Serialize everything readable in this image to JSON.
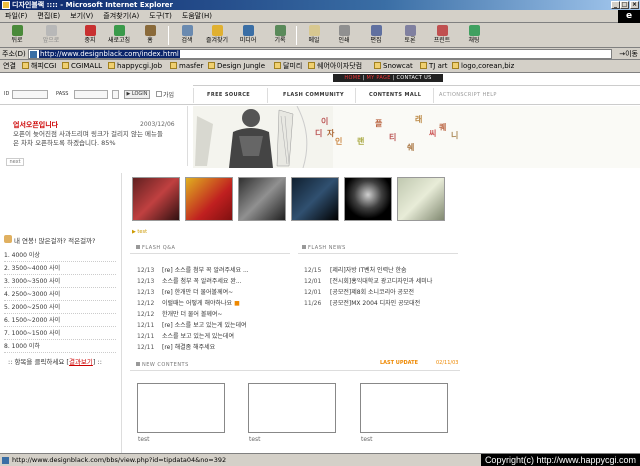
{
  "window": {
    "title": "디자인블랙 :::: - Microsoft Internet Explorer"
  },
  "menu": [
    "파일(F)",
    "편집(E)",
    "보기(V)",
    "즐겨찾기(A)",
    "도구(T)",
    "도움말(H)"
  ],
  "toolbar": {
    "back": "뒤로",
    "forward": "앞으로",
    "stop": "중지",
    "refresh": "새로고침",
    "home": "홈",
    "search": "검색",
    "favorites": "즐겨찾기",
    "media": "미디어",
    "history": "기록",
    "mail": "메일",
    "print": "인쇄",
    "edit": "편집",
    "discuss": "토론",
    "printpro": "프린트",
    "messenger": "채팅"
  },
  "address": {
    "label": "주소(D)",
    "url": "http://www.designblack.com/index.html",
    "go": "이동"
  },
  "links": {
    "label": "연결",
    "items": [
      "해피CGI",
      "CGIMALL",
      "happycgi.Job",
      "masfer",
      "Design Jungle",
      "달미리",
      "쉐어아이자닷컴",
      "Snowcat",
      "TJ art",
      "logo,corean,biz"
    ]
  },
  "site": {
    "topmenu": {
      "home": "HOME",
      "mypage": "MY PAGE",
      "contact": "CONTACT US"
    },
    "login": {
      "id_label": "ID",
      "pw_label": "PASS",
      "button": "▶ LOGIN",
      "join": "가입"
    },
    "nav": [
      "FREE SOURCE",
      "FLASH COMMUNITY",
      "CONTENTS MALL",
      "ACTIONSCRIPT HELP"
    ],
    "notice": {
      "title": "업서오픈입니다",
      "date": "2003/12/06",
      "body": "오픈이 늦어진점 사과드리며 링크가 걸리지 않는 메뉴들은 차차 오픈하도록 하겠습니다. 85%",
      "next": "next"
    },
    "hero_chars": [
      "이",
      "디",
      "자",
      "인",
      "플",
      "랜",
      "래",
      "쉐",
      "씨",
      "퀘",
      "니",
      "티"
    ],
    "test_link": "▶ test",
    "poll": {
      "question": "내 연봉! 많은걸까? 적은걸까?",
      "options": [
        "1. 4000 이상",
        "2. 3500~4000 사이",
        "3. 3000~3500 사이",
        "4. 2500~3000 사이",
        "5. 2000~2500 사이",
        "6. 1500~2000 사이",
        "7. 1000~1500 사이",
        "8. 1000 이하"
      ],
      "hint": ":: 항목을 클릭하세요 ",
      "result": "결과보기",
      "close": " ::"
    },
    "flash_qna": {
      "title": "FLASH Q&A",
      "rows": [
        {
          "date": "12/13",
          "text": "[re] 소스를 첨부 꼭 알려주세요 ..."
        },
        {
          "date": "12/13",
          "text": "소스를 첨부 꼭 알려주세요 완..."
        },
        {
          "date": "12/13",
          "text": "[re] 한개만 더 물어볼께여~"
        },
        {
          "date": "12/12",
          "text": "이럴때는 어떻게 해야하나요"
        },
        {
          "date": "12/12",
          "text": "한개만 더 물어 볼께여~"
        },
        {
          "date": "12/11",
          "text": "[re] 소스를 보고 있는게 있는데여"
        },
        {
          "date": "12/11",
          "text": "소스를 보고 있는게 있는데여"
        },
        {
          "date": "12/11",
          "text": "[re] 해결좀 해주세요"
        }
      ]
    },
    "flash_news": {
      "title": "FLASH NEWS",
      "rows": [
        {
          "date": "12/15",
          "text": "[제리]자방 IT벤처 인력난 한숨"
        },
        {
          "date": "12/01",
          "text": "[전시회]홍익대학교 광고디자인과 세미나"
        },
        {
          "date": "12/01",
          "text": "[공모전]제8회 소니코리아 공모전"
        },
        {
          "date": "11/26",
          "text": "[공모전]MX 2004 디자인 공모대전"
        }
      ]
    },
    "new_contents": {
      "title": "NEW CONTENTS",
      "last_update_label": "LAST UPDATE",
      "last_update": "02/11/03"
    },
    "boxes": [
      "test",
      "test",
      "test"
    ]
  },
  "status": {
    "url": "http://www.designblack.com/bbs/view.php?id=tipdata04&no=392",
    "copyright": "Copyright(c) http://www.happycgi.com"
  },
  "colors": {
    "accent_red": "#cc0000",
    "title_blue": "#0a246a",
    "chrome": "#d4d0c8"
  }
}
